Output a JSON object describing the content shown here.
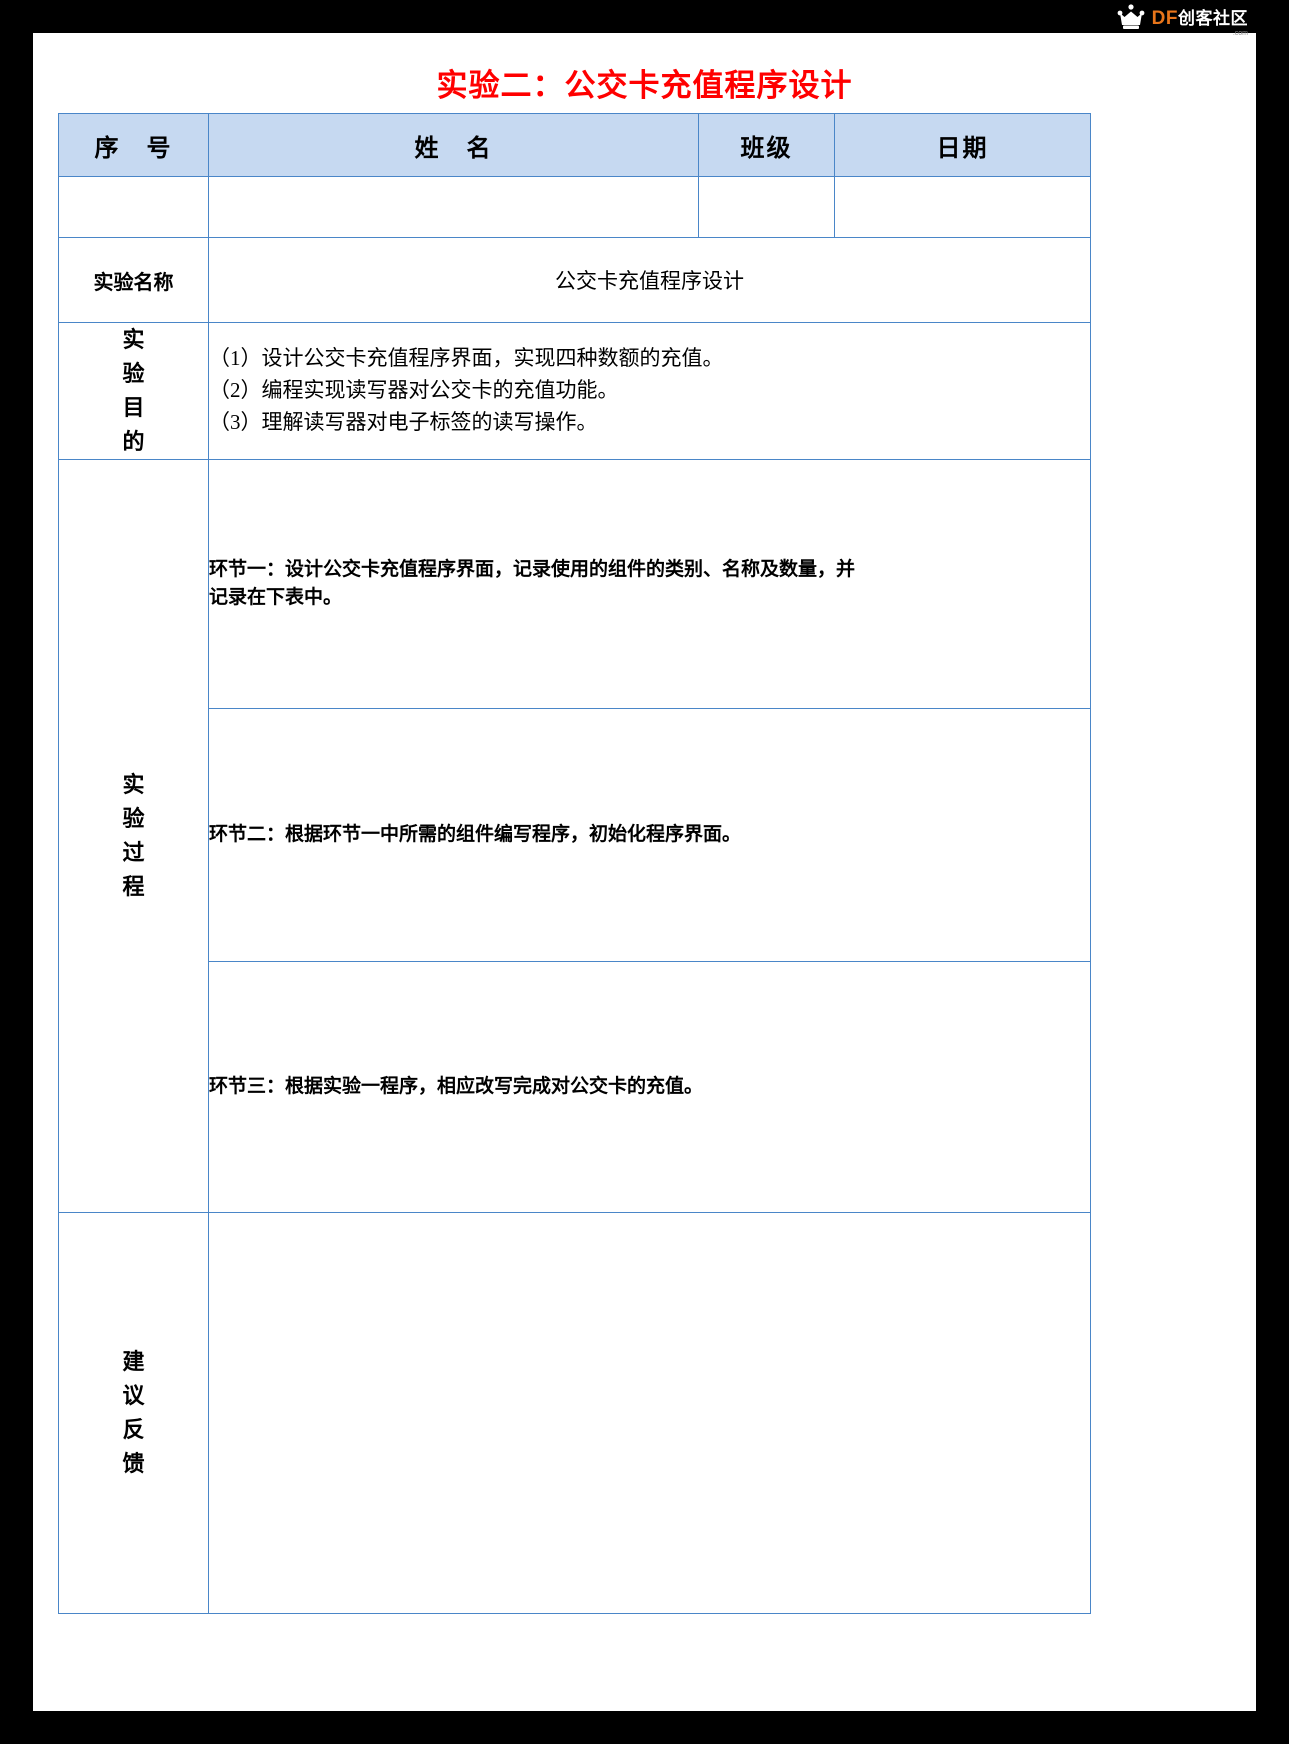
{
  "logo": {
    "icon": "crown-robot-icon",
    "df_text": "DF",
    "cn_text": "创客社区",
    "domain_text": ".com"
  },
  "document": {
    "title": "实验二：公交卡充值程序设计",
    "title_color": "#ff0000",
    "border_color": "#4a86c8",
    "header_fill": "#c6d9f1"
  },
  "table": {
    "header": {
      "no": "序　号",
      "name": "姓　名",
      "class": "班级",
      "date": "日期"
    },
    "values": {
      "no": "",
      "name": "",
      "class": "",
      "date": ""
    },
    "exp_name_label": "实验名称",
    "exp_name_value": "公交卡充值程序设计",
    "aim_label": [
      "实",
      "验",
      "目",
      "的"
    ],
    "aims": [
      "（1）设计公交卡充值程序界面，实现四种数额的充值。",
      "（2）编程实现读写器对公交卡的充值功能。",
      "（3）理解读写器对电子标签的读写操作。"
    ],
    "process_label": [
      "实",
      "验",
      "过",
      "程"
    ],
    "steps": [
      {
        "line1": "环节一：设计公交卡充值程序界面，记录使用的组件的类别、名称及数量，并",
        "line2": "记录在下表中。",
        "answer": ""
      },
      {
        "line1": "环节二：根据环节一中所需的组件编写程序，初始化程序界面。",
        "line2": "",
        "answer": ""
      },
      {
        "line1": "环节三：根据实验一程序，相应改写完成对公交卡的充值。",
        "line2": "",
        "answer": ""
      }
    ],
    "feedback_label": [
      "建",
      "议",
      "反",
      "馈"
    ],
    "feedback_value": ""
  }
}
